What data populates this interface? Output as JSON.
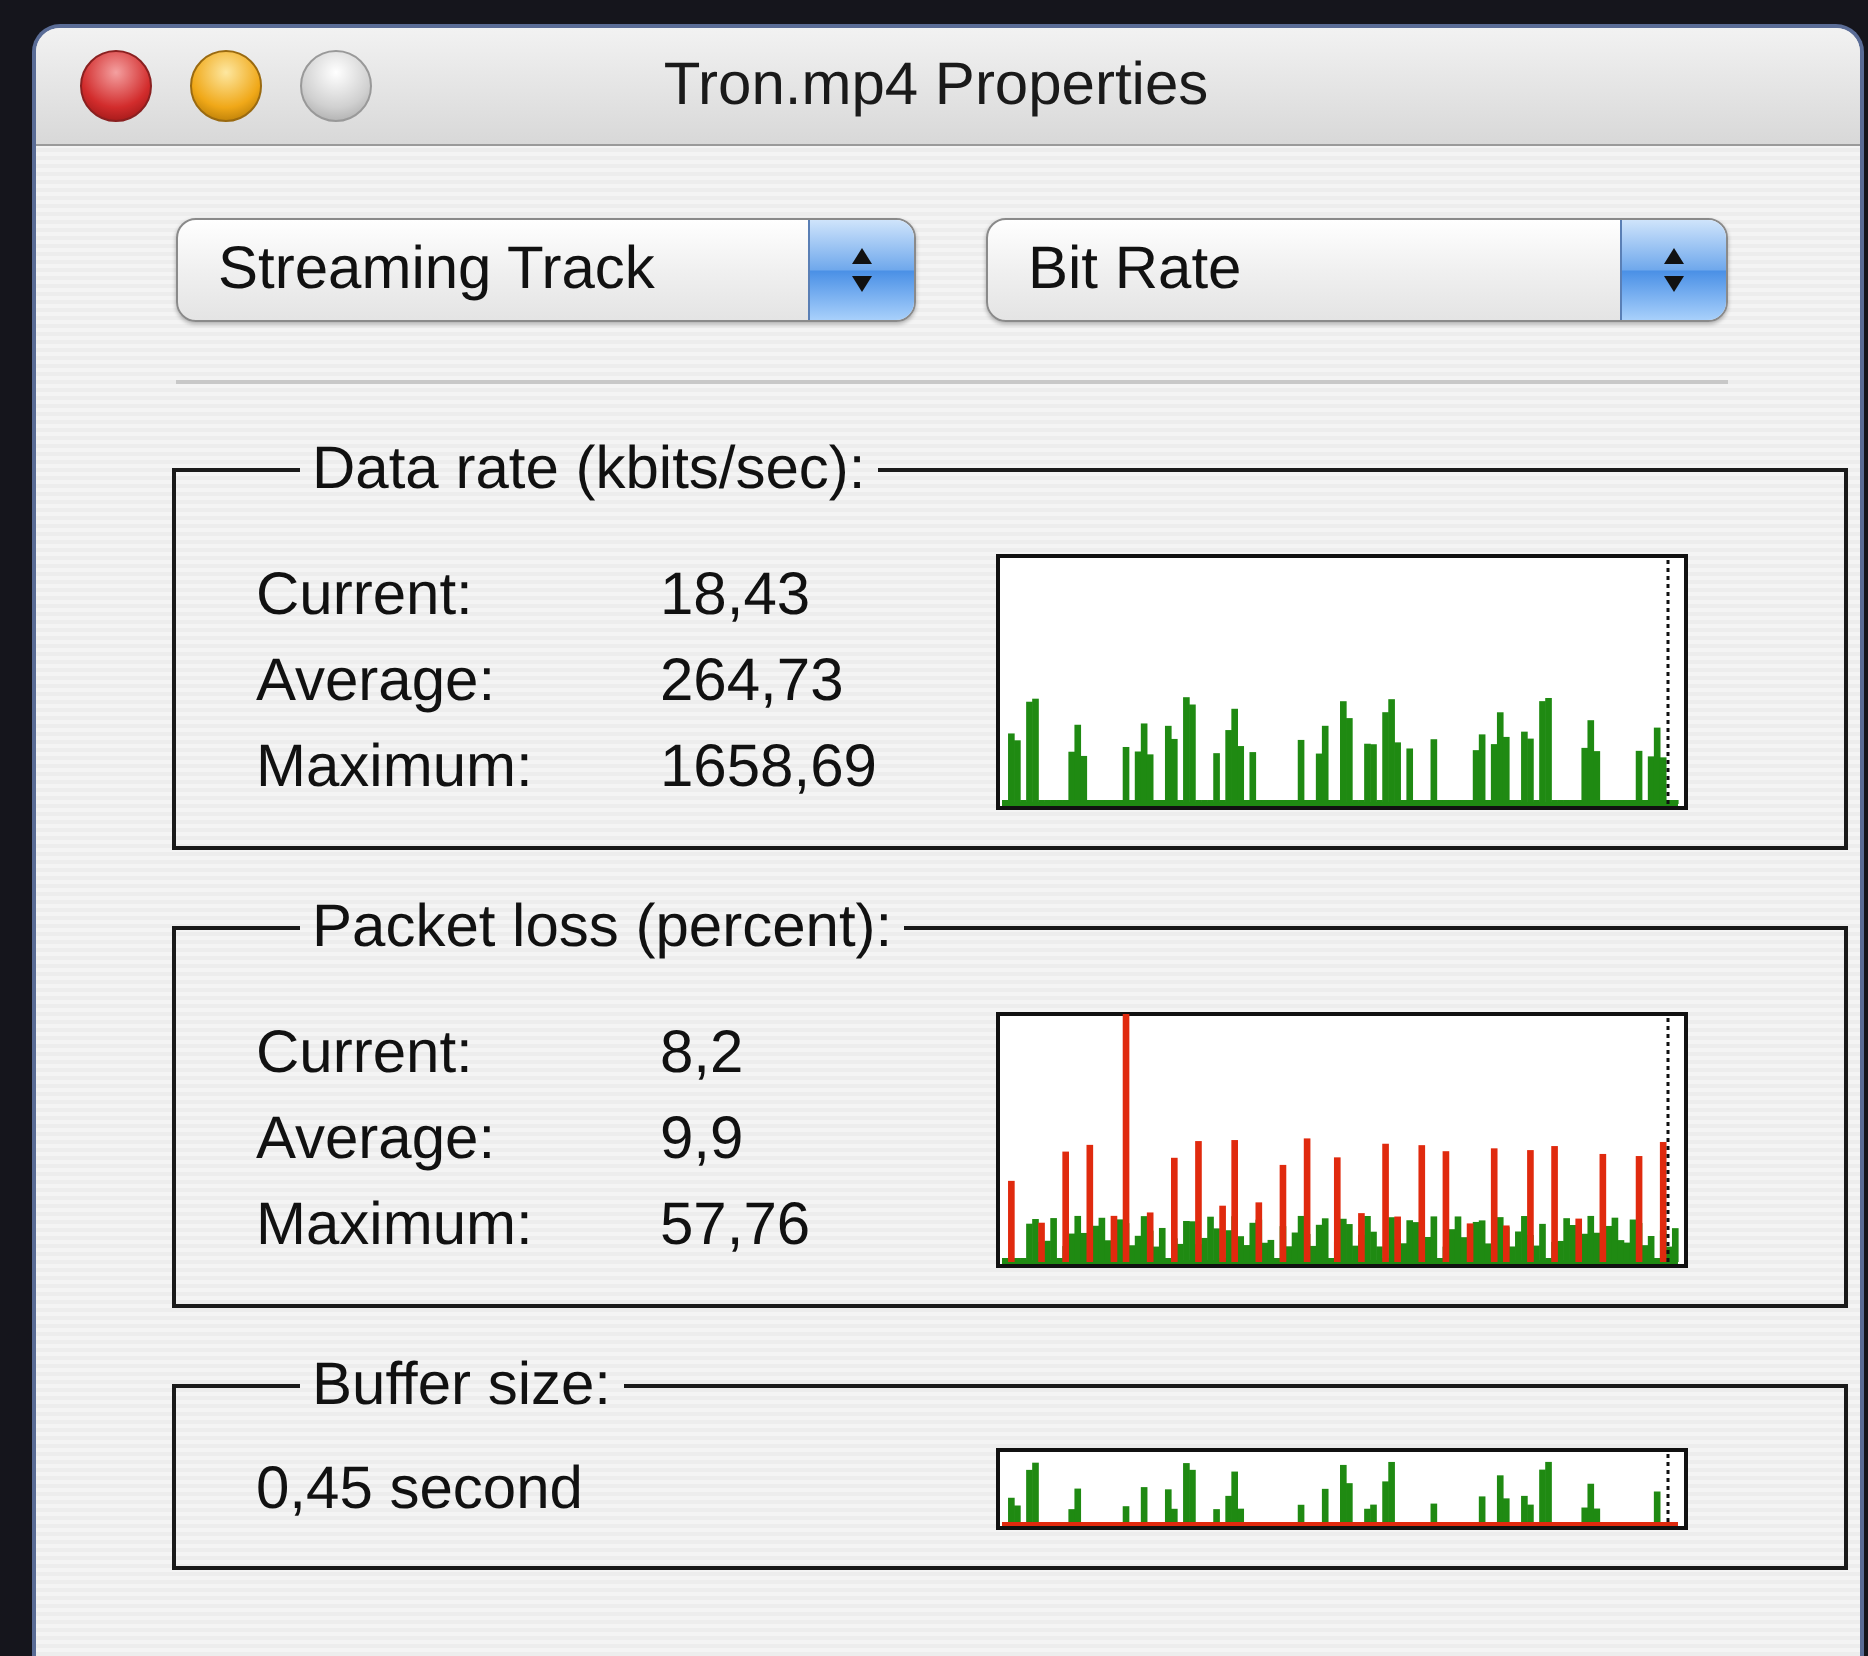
{
  "window": {
    "title": "Tron.mp4 Properties"
  },
  "popups": [
    {
      "value": "Streaming Track"
    },
    {
      "value": "Bit Rate"
    }
  ],
  "groups": [
    {
      "kind": "stats",
      "title": "Data rate (kbits/sec):",
      "rows": [
        {
          "label": "Current:",
          "value": "18,43"
        },
        {
          "label": "Average:",
          "value": "264,73"
        },
        {
          "label": "Maximum:",
          "value": "1658,69"
        }
      ]
    },
    {
      "kind": "stats",
      "title": "Packet loss (percent):",
      "rows": [
        {
          "label": "Current:",
          "value": "8,2"
        },
        {
          "label": "Average:",
          "value": "9,9"
        },
        {
          "label": "Maximum:",
          "value": "57,76"
        }
      ]
    },
    {
      "kind": "single",
      "title": "Buffer size:",
      "value": "0,45 second"
    }
  ]
}
